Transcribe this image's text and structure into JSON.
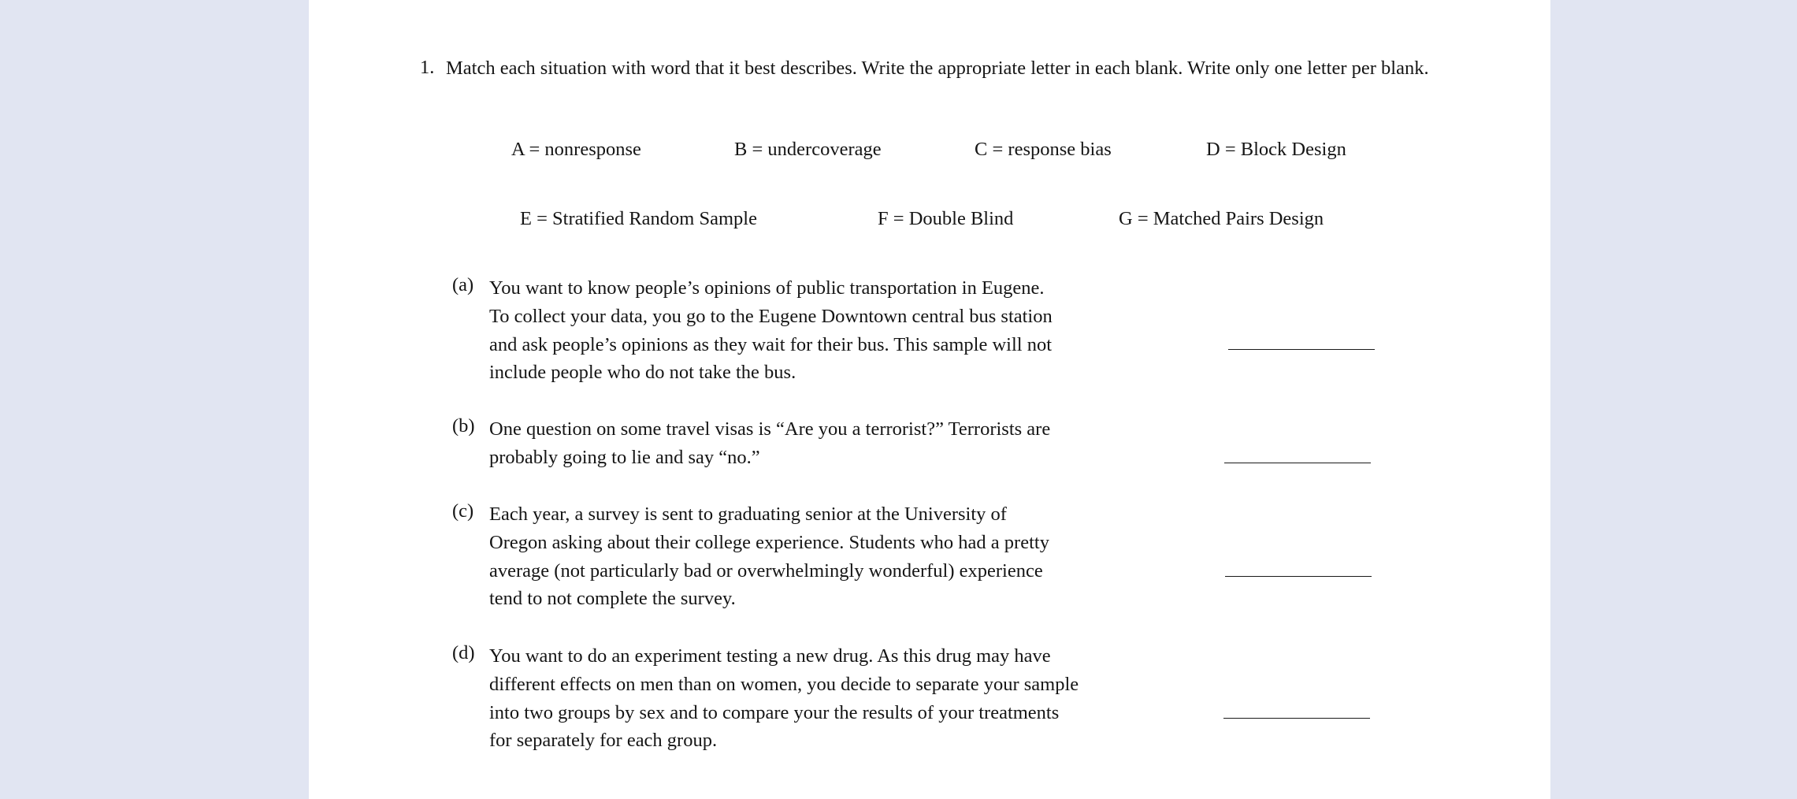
{
  "question": {
    "number": "1.",
    "text": "Match each situation with word that it best describes. Write the appropriate letter in each blank. Write only one letter per blank."
  },
  "legend": {
    "row1": [
      {
        "key": "A",
        "text": "A = nonresponse"
      },
      {
        "key": "B",
        "text": "B = undercoverage"
      },
      {
        "key": "C",
        "text": "C = response bias"
      },
      {
        "key": "D",
        "text": "D = Block Design"
      }
    ],
    "row2": [
      {
        "key": "E",
        "text": "E = Stratified Random Sample"
      },
      {
        "key": "F",
        "text": "F = Double Blind"
      },
      {
        "key": "G",
        "text": "G = Matched Pairs Design"
      }
    ]
  },
  "items": [
    {
      "label": "(a)",
      "lines": [
        "You want to know people’s opinions of public transportation in Eugene.",
        "To collect your data, you go to the Eugene Downtown central bus station",
        "and ask people’s opinions as they wait for their bus. This sample will not",
        "include people who do not take the bus."
      ],
      "answer": ""
    },
    {
      "label": "(b)",
      "lines": [
        "One question on some travel visas is “Are you a terrorist?” Terrorists are",
        "probably going to lie and say “no.”"
      ],
      "answer": ""
    },
    {
      "label": "(c)",
      "lines": [
        "Each year, a survey is sent to graduating senior at the University of",
        "Oregon asking about their college experience. Students who had a pretty",
        "average (not particularly bad or overwhelmingly wonderful) experience",
        "tend to not complete the survey."
      ],
      "answer": ""
    },
    {
      "label": "(d)",
      "lines": [
        "You want to do an experiment testing a new drug. As this drug may have",
        "different effects on men than on women, you decide to separate your sample",
        "into two groups by sex and to compare your the results of your treatments",
        "for separately for each group."
      ],
      "answer": ""
    }
  ]
}
